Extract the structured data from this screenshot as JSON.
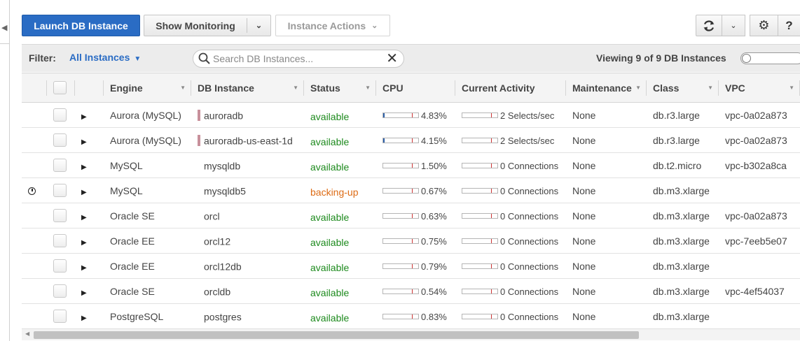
{
  "toolbar": {
    "launch_label": "Launch DB Instance",
    "monitoring_label": "Show Monitoring",
    "actions_label": "Instance Actions"
  },
  "icons": {
    "refresh": "refresh-icon",
    "settings": "gear-icon",
    "help": "help-icon",
    "search": "search-icon",
    "clear": "close-icon",
    "expand": "expand-triangle-icon",
    "pending": "clock-icon"
  },
  "filter": {
    "label": "Filter:",
    "value": "All Instances",
    "search_placeholder": "Search DB Instances...",
    "viewing": "Viewing 9 of 9 DB Instances"
  },
  "columns": [
    "Engine",
    "DB Instance",
    "Status",
    "CPU",
    "Current Activity",
    "Maintenance",
    "Class",
    "VPC"
  ],
  "colors": {
    "primary": "#2a6cc4",
    "available": "#1d8a1d",
    "backing_up": "#dd6b14",
    "aurora_marker": "#c8909b"
  },
  "rows": [
    {
      "engine": "Aurora (MySQL)",
      "instance": "auroradb",
      "aurora": true,
      "status": "available",
      "cpu": "4.83%",
      "cpu_level": 0.0483,
      "activity": "2 Selects/sec",
      "maintenance": "None",
      "class": "db.r3.large",
      "vpc": "vpc-0a02a873"
    },
    {
      "engine": "Aurora (MySQL)",
      "instance": "auroradb-us-east-1d",
      "aurora": true,
      "status": "available",
      "cpu": "4.15%",
      "cpu_level": 0.0415,
      "activity": "2 Selects/sec",
      "maintenance": "None",
      "class": "db.r3.large",
      "vpc": "vpc-0a02a873"
    },
    {
      "engine": "MySQL",
      "instance": "mysqldb",
      "aurora": false,
      "status": "available",
      "cpu": "1.50%",
      "cpu_level": 0.015,
      "activity": "0 Connections",
      "maintenance": "None",
      "class": "db.t2.micro",
      "vpc": "vpc-b302a8ca"
    },
    {
      "engine": "MySQL",
      "instance": "mysqldb5",
      "aurora": false,
      "status": "backing-up",
      "pending": true,
      "cpu": "0.67%",
      "cpu_level": 0.0067,
      "activity": "0 Connections",
      "maintenance": "None",
      "class": "db.m3.xlarge",
      "vpc": ""
    },
    {
      "engine": "Oracle SE",
      "instance": "orcl",
      "aurora": false,
      "status": "available",
      "cpu": "0.63%",
      "cpu_level": 0.0063,
      "activity": "0 Connections",
      "maintenance": "None",
      "class": "db.m3.xlarge",
      "vpc": "vpc-0a02a873"
    },
    {
      "engine": "Oracle EE",
      "instance": "orcl12",
      "aurora": false,
      "status": "available",
      "cpu": "0.75%",
      "cpu_level": 0.0075,
      "activity": "0 Connections",
      "maintenance": "None",
      "class": "db.m3.xlarge",
      "vpc": "vpc-7eeb5e07"
    },
    {
      "engine": "Oracle EE",
      "instance": "orcl12db",
      "aurora": false,
      "status": "available",
      "cpu": "0.79%",
      "cpu_level": 0.0079,
      "activity": "0 Connections",
      "maintenance": "None",
      "class": "db.m3.xlarge",
      "vpc": ""
    },
    {
      "engine": "Oracle SE",
      "instance": "orcldb",
      "aurora": false,
      "status": "available",
      "cpu": "0.54%",
      "cpu_level": 0.0054,
      "activity": "0 Connections",
      "maintenance": "None",
      "class": "db.m3.xlarge",
      "vpc": "vpc-4ef54037"
    },
    {
      "engine": "PostgreSQL",
      "instance": "postgres",
      "aurora": false,
      "status": "available",
      "cpu": "0.83%",
      "cpu_level": 0.0083,
      "activity": "0 Connections",
      "maintenance": "None",
      "class": "db.m3.xlarge",
      "vpc": ""
    }
  ]
}
